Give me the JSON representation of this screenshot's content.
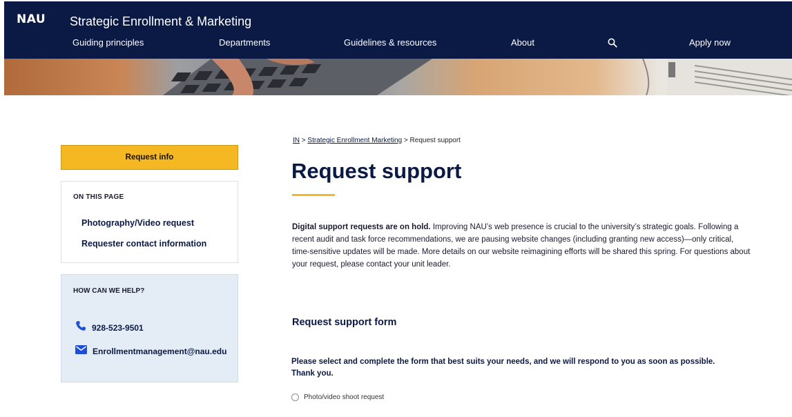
{
  "header": {
    "logo": "NAU",
    "site_title": "Strategic Enrollment & Marketing",
    "nav": [
      "Guiding principles",
      "Departments",
      "Guidelines & resources",
      "About",
      "Apply now"
    ],
    "search_icon": "search-icon"
  },
  "sidebar": {
    "request_info": "Request info",
    "on_this_page": {
      "title": "ON THIS PAGE",
      "links": [
        "Photography/Video request",
        "Requester contact information"
      ]
    },
    "help": {
      "title": "HOW CAN WE HELP?",
      "phone": "928-523-9501",
      "email": "Enrollmentmanagement@nau.edu",
      "phone_icon": "phone-icon",
      "email_icon": "mail-icon"
    }
  },
  "breadcrumb": {
    "items": [
      "IN",
      "Strategic Enrollment Marketing",
      "Request support"
    ],
    "separator": ">"
  },
  "main": {
    "title": "Request support",
    "notice_bold": "Digital support requests are on hold.",
    "notice_text": " Improving NAU’s web presence is crucial to the university’s strategic goals. Following a recent audit and task force recommendations, we are pausing website changes (including granting new access)—only critical, time-sensitive updates will be made. More details on our website reimagining efforts will be shared this spring.  For questions about your request, please contact your unit leader.",
    "form_heading": "Request support form",
    "form_instructions": "Please select and complete the form that best suits your needs, and we will respond to you as soon as possible. Thank you.",
    "options": [
      "Photo/video shoot request"
    ]
  },
  "colors": {
    "navy": "#0b1a45",
    "gold": "#f5b823",
    "help_bg": "#e4edf6"
  }
}
